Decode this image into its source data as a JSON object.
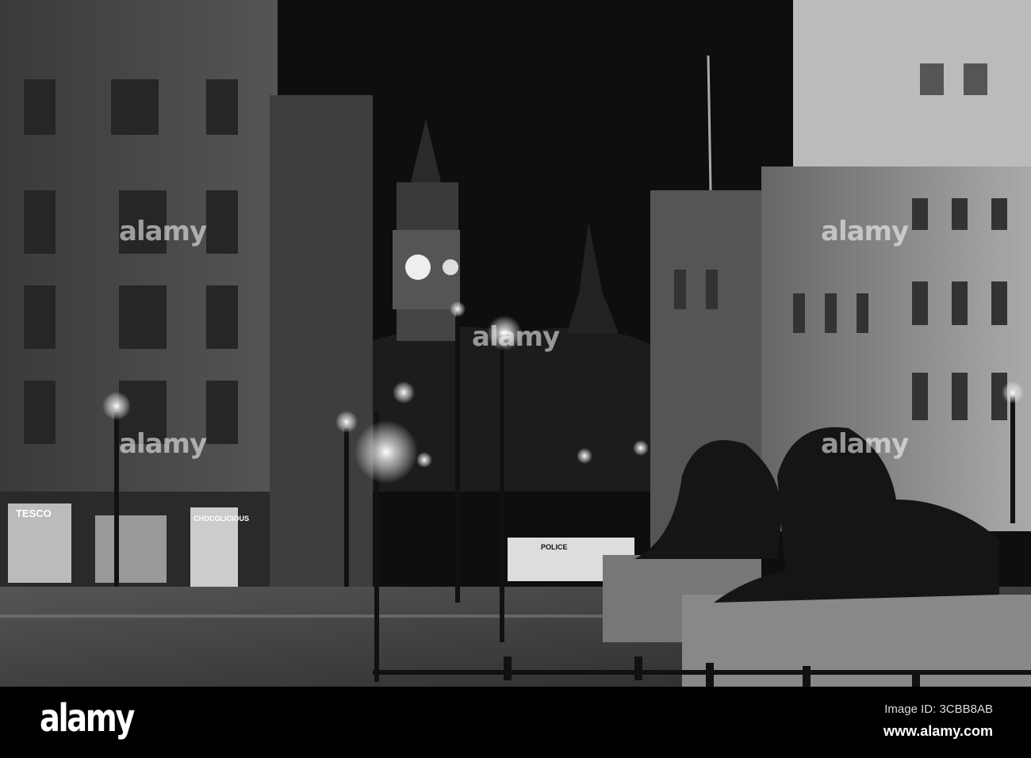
{
  "watermark": {
    "text": "alamy"
  },
  "signs": {
    "tesco": "TESCO",
    "chocolicious": "CHOCOLICIOUS",
    "police": "POLICE"
  },
  "footer": {
    "logo": "alamy",
    "image_id": "Image ID: 3CBB8AB",
    "url": "www.alamy.com"
  }
}
